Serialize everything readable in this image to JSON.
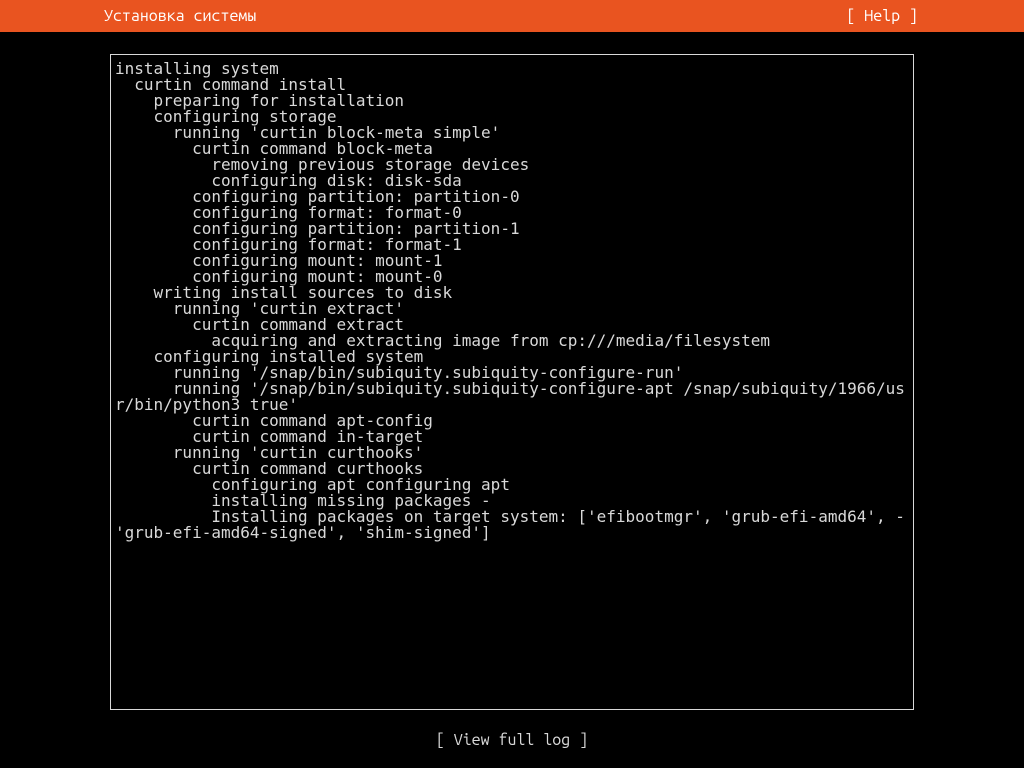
{
  "header": {
    "title": "Установка системы",
    "help": "[ Help ]"
  },
  "log": {
    "lines": [
      "installing system",
      "  curtin command install",
      "    preparing for installation",
      "    configuring storage",
      "      running 'curtin block-meta simple'",
      "        curtin command block-meta",
      "          removing previous storage devices",
      "          configuring disk: disk-sda",
      "        configuring partition: partition-0",
      "        configuring format: format-0",
      "        configuring partition: partition-1",
      "        configuring format: format-1",
      "        configuring mount: mount-1",
      "        configuring mount: mount-0",
      "    writing install sources to disk",
      "      running 'curtin extract'",
      "        curtin command extract",
      "          acquiring and extracting image from cp:///media/filesystem",
      "    configuring installed system",
      "      running '/snap/bin/subiquity.subiquity-configure-run'",
      "      running '/snap/bin/subiquity.subiquity-configure-apt /snap/subiquity/1966/usr/bin/python3 true'",
      "        curtin command apt-config",
      "        curtin command in-target",
      "      running 'curtin curthooks'",
      "        curtin command curthooks",
      "          configuring apt configuring apt",
      "          installing missing packages -",
      "          Installing packages on target system: ['efibootmgr', 'grub-efi-amd64', - 'grub-efi-amd64-signed', 'shim-signed']"
    ]
  },
  "footer": {
    "view_full_log": "[ View full log ]"
  },
  "colors": {
    "accent": "#e95420",
    "bg": "#000000",
    "fg": "#d9d9d9",
    "white": "#ffffff"
  }
}
